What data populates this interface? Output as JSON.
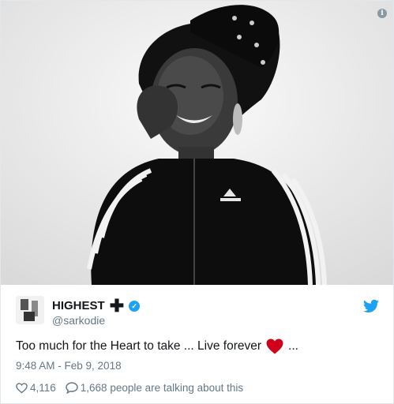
{
  "tweet": {
    "display_name": "HIGHEST",
    "name_glyph": "✚",
    "handle": "@sarkodie",
    "text_before": "Too much for the Heart to take ... Live forever",
    "text_after": "...",
    "timestamp": "9:48 AM - Feb 9, 2018",
    "likes_count": "4,116",
    "replies_text": "1,668 people are talking about this"
  },
  "icons": {
    "info": "info-icon",
    "verified": "verified-badge-icon",
    "twitter": "twitter-bird-icon",
    "like": "heart-outline-icon",
    "reply": "speech-bubble-icon",
    "emoji": "red-heart-emoji"
  },
  "colors": {
    "twitter_blue": "#1da1f2",
    "secondary_text": "#657786",
    "emoji_red": "#d0021b"
  }
}
